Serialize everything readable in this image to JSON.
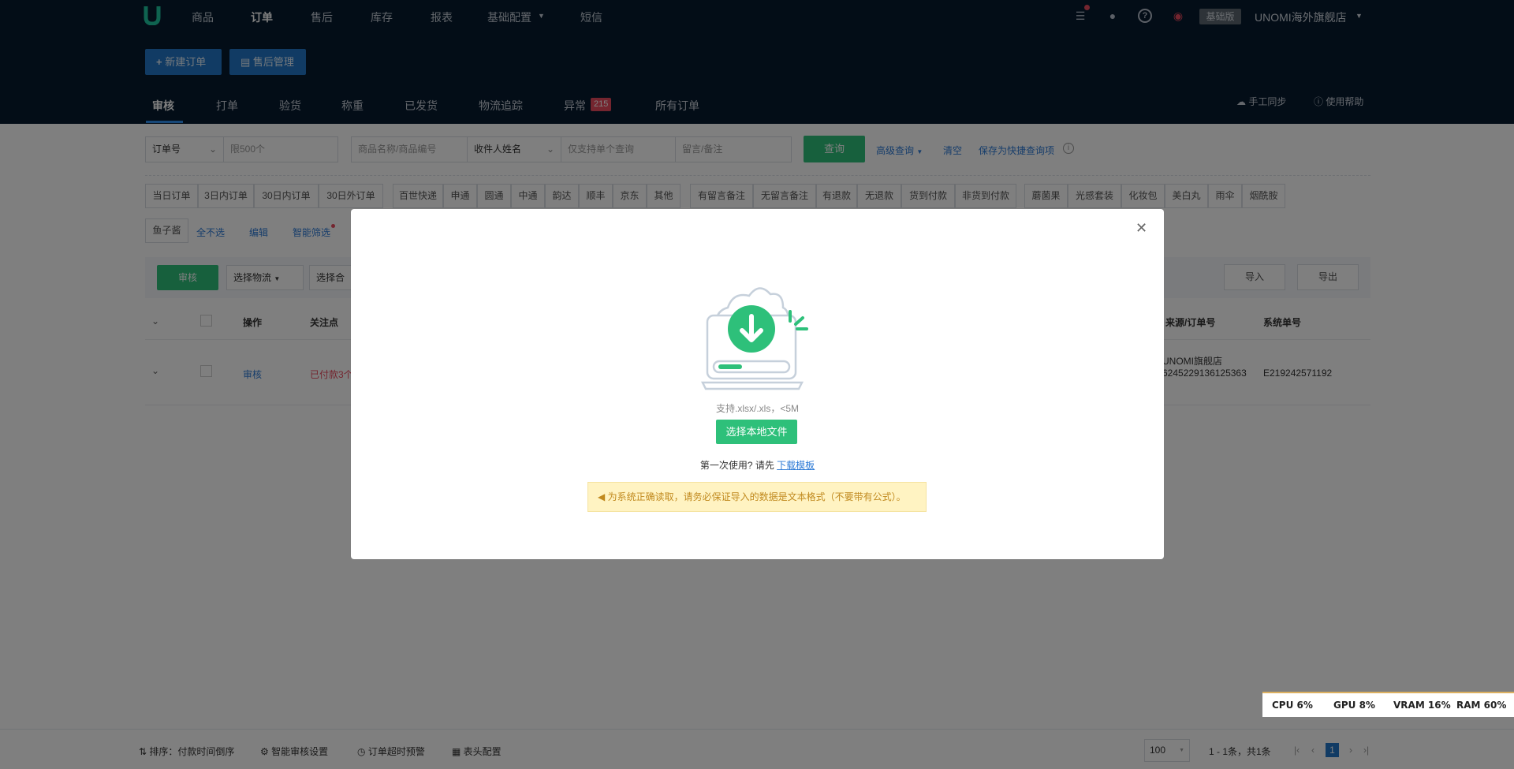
{
  "nav": {
    "items": [
      "商品",
      "订单",
      "售后",
      "库存",
      "报表",
      "基础配置",
      "短信"
    ],
    "active": "订单",
    "edition_badge": "基础版",
    "store_name": "UNOMI海外旗舰店"
  },
  "actions": {
    "new_order": "新建订单",
    "after_sale": "售后管理"
  },
  "tabs": {
    "items": [
      "审核",
      "打单",
      "验货",
      "称重",
      "已发货",
      "物流追踪",
      "异常",
      "所有订单"
    ],
    "abnormal_count": "215",
    "manual_sync": "手工同步",
    "help": "使用帮助"
  },
  "search": {
    "order_type": "订单号",
    "order_placeholder": "限500个",
    "goods_placeholder": "商品名称/商品编号",
    "receiver_type": "收件人姓名",
    "receiver_placeholder": "仅支持单个查询",
    "memo_placeholder": "留言/备注",
    "query_button": "查询",
    "advanced": "高级查询",
    "clear": "清空",
    "save_quick": "保存为快捷查询项"
  },
  "filters": {
    "group1": [
      "当日订单",
      "3日内订单",
      "30日内订单",
      "30日外订单"
    ],
    "group2": [
      "百世快递",
      "申通",
      "圆通",
      "中通",
      "韵达",
      "顺丰",
      "京东",
      "其他"
    ],
    "group3": [
      "有留言备注",
      "无留言备注",
      "有退款",
      "无退款",
      "货到付款",
      "非货到付款"
    ],
    "group4": [
      "蘑菌果",
      "光感套装",
      "化妆包",
      "美白丸",
      "雨伞",
      "烟酰胺"
    ],
    "row2_chip": "鱼子酱",
    "deselect_all": "全不选",
    "edit": "编辑",
    "smart_filter": "智能筛选"
  },
  "toolbar": {
    "audit": "审核",
    "choose_logistics": "选择物流",
    "choose_combo": "选择合",
    "import": "导入",
    "export": "导出"
  },
  "table": {
    "headers": {
      "operation": "操作",
      "focus": "关注点",
      "source": "来源/订单号",
      "system_no": "系统单号"
    },
    "rows": [
      {
        "operation": "审核",
        "focus": "已付款3个",
        "source_store": "UNOMI旗舰店",
        "source_order": "6245229136125363",
        "system_no": "E219242571192"
      }
    ]
  },
  "modal": {
    "support_text": "支持.xlsx/.xls，<5M",
    "choose_file": "选择本地文件",
    "first_use": "第一次使用? 请先",
    "download_template": "下载模板",
    "notice": "为系统正确读取，请务必保证导入的数据是文本格式（不要带有公式）。"
  },
  "bottom": {
    "sort": "排序：付款时间倒序",
    "smart_audit": "智能审核设置",
    "timeout_warning": "订单超时预警",
    "header_config": "表头配置",
    "page_size": "100",
    "summary": "1 - 1条，共1条",
    "current_page": "1"
  },
  "perf": {
    "cpu": "CPU  6%",
    "gpu": "GPU  8%",
    "vram": "VRAM 16%",
    "ram": "RAM 60%"
  },
  "colors": {
    "header_bg": "#061a2e",
    "primary_blue": "#2277c8",
    "accent_green": "#2ec07a",
    "abnormal_red": "#e84a5f",
    "notice_bg": "#fff3c2"
  }
}
